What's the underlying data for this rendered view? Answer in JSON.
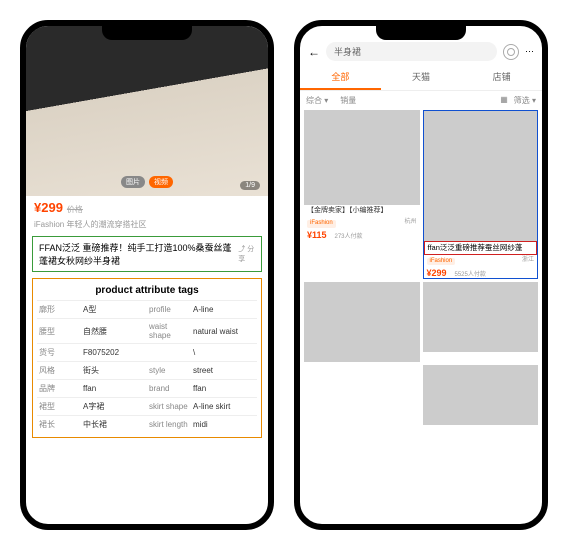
{
  "left": {
    "hero": {
      "pill1": "图片",
      "pill2": "视频",
      "index": "1/9"
    },
    "price": "¥299",
    "strike": "价格",
    "sub": "iFashion 年轻人的潮流穿搭社区",
    "title": "FFAN泛泛 重磅推荐！纯手工打造100%桑蚕丝蓬蓬裙女秋网纱半身裙",
    "share": "⤴ 分享",
    "attr_title": "product attribute tags",
    "attrs": [
      {
        "kcn": "廓形",
        "vcn": "A型",
        "ken": "profile",
        "ven": "A-line"
      },
      {
        "kcn": "腰型",
        "vcn": "自然腰",
        "ken": "waist shape",
        "ven": "natural waist"
      },
      {
        "kcn": "货号",
        "vcn": "F8075202",
        "ken": "",
        "ven": "\\"
      },
      {
        "kcn": "风格",
        "vcn": "街头",
        "ken": "style",
        "ven": "street"
      },
      {
        "kcn": "品牌",
        "vcn": "ffan",
        "ken": "brand",
        "ven": "ffan"
      },
      {
        "kcn": "裙型",
        "vcn": "A字裙",
        "ken": "skirt shape",
        "ven": "A-line skirt"
      },
      {
        "kcn": "裙长",
        "vcn": "中长裙",
        "ken": "skirt length",
        "ven": "midi"
      }
    ]
  },
  "right": {
    "search": {
      "query": "半身裙"
    },
    "tabs": [
      "全部",
      "天猫",
      "店铺"
    ],
    "sort": {
      "a": "综合 ▾",
      "b": "销量",
      "c": "筛选 ▾"
    },
    "cards": {
      "c1": {
        "title": "【金牌卖家】【小编推荐】",
        "badge": "iFashion",
        "price": "¥115",
        "sold": "273人付款",
        "loc": "杭州"
      },
      "c2_title": "ffan泛泛重磅推荐蚕丝网纱蓬",
      "c3": {
        "badge": "iFashion",
        "price": "¥299",
        "sold": "5525人付款",
        "loc": "浙江"
      }
    }
  }
}
